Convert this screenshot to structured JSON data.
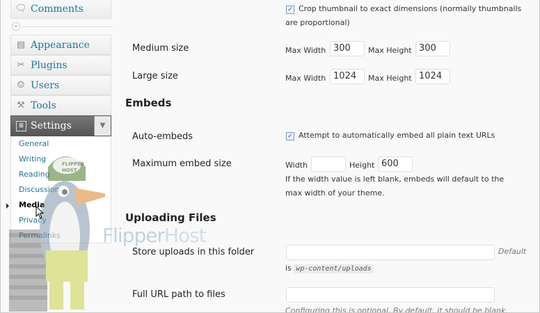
{
  "sidebar": {
    "comments_label": "Comments",
    "appearance_label": "Appearance",
    "plugins_label": "Plugins",
    "users_label": "Users",
    "tools_label": "Tools",
    "settings_label": "Settings",
    "submenu": [
      {
        "label": "General"
      },
      {
        "label": "Writing"
      },
      {
        "label": "Reading"
      },
      {
        "label": "Discussion"
      },
      {
        "label": "Media"
      },
      {
        "label": "Privacy"
      },
      {
        "label": "Permalinks"
      }
    ]
  },
  "watermark": {
    "flipper": "Flipper",
    "host": "Host",
    "badge": "FLIPPER HOST"
  },
  "thumbnail": {
    "crop_label_line1": "Crop thumbnail to exact dimensions (normally thumbnails",
    "crop_label_line2": "are proportional)"
  },
  "medium": {
    "label": "Medium size",
    "max_width_label": "Max Width",
    "max_width": "300",
    "max_height_label": "Max Height",
    "max_height": "300"
  },
  "large": {
    "label": "Large size",
    "max_width_label": "Max Width",
    "max_width": "1024",
    "max_height_label": "Max Height",
    "max_height": "1024"
  },
  "embeds": {
    "title": "Embeds",
    "auto_label": "Auto-embeds",
    "auto_text": "Attempt to automatically embed all plain text URLs",
    "max_label": "Maximum embed size",
    "width_label": "Width",
    "width_value": "",
    "height_label": "Height",
    "height_value": "600",
    "help_line1": "If the width value is left blank, embeds will default to the",
    "help_line2": "max width of your theme."
  },
  "uploading": {
    "title": "Uploading Files",
    "store_label": "Store uploads in this folder",
    "store_value": "",
    "default_word": "Default",
    "is_word": "is",
    "default_path": "wp-content/uploads",
    "url_label": "Full URL path to files",
    "url_value": "",
    "url_help": "Configuring this is optional. By default, it should be blank."
  }
}
